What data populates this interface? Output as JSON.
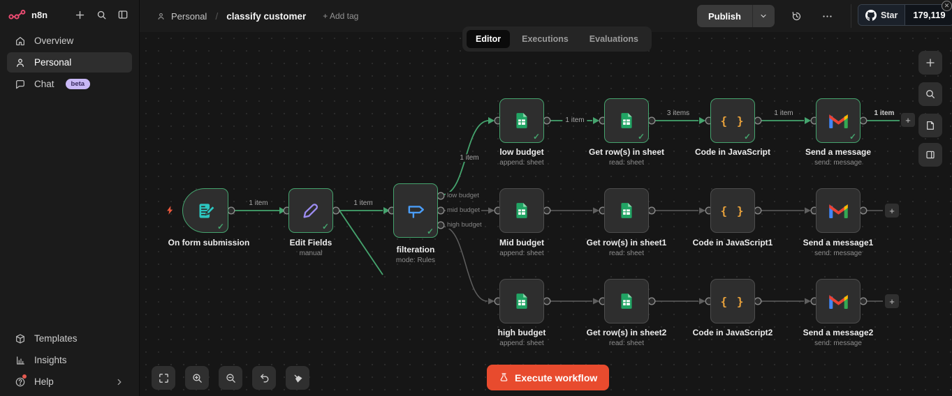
{
  "brand": {
    "name": "n8n"
  },
  "sidebar": {
    "items": [
      {
        "label": "Overview"
      },
      {
        "label": "Personal"
      },
      {
        "label": "Chat",
        "badge": "beta"
      }
    ],
    "footer": [
      {
        "label": "Templates"
      },
      {
        "label": "Insights"
      },
      {
        "label": "Help"
      }
    ]
  },
  "header": {
    "breadcrumb": {
      "project": "Personal",
      "separator": "/",
      "title": "classify customer"
    },
    "add_tag": "+ Add tag",
    "publish": "Publish",
    "github": {
      "star": "Star",
      "count": "179,119"
    }
  },
  "tabs": [
    {
      "label": "Editor"
    },
    {
      "label": "Executions"
    },
    {
      "label": "Evaluations"
    }
  ],
  "canvas": {
    "nodes": [
      {
        "name": "On form submission",
        "subtitle": ""
      },
      {
        "name": "Edit Fields",
        "subtitle": "manual"
      },
      {
        "name": "filteration",
        "subtitle": "mode: Rules"
      },
      {
        "name": "low budget",
        "subtitle": "append: sheet"
      },
      {
        "name": "Get row(s) in sheet",
        "subtitle": "read: sheet"
      },
      {
        "name": "Code in JavaScript",
        "subtitle": ""
      },
      {
        "name": "Send a message",
        "subtitle": "send: message"
      },
      {
        "name": "Mid budget",
        "subtitle": "append: sheet"
      },
      {
        "name": "Get row(s) in sheet1",
        "subtitle": "read: sheet"
      },
      {
        "name": "Code in JavaScript1",
        "subtitle": ""
      },
      {
        "name": "Send a message1",
        "subtitle": "send: message"
      },
      {
        "name": "high budget",
        "subtitle": "append: sheet"
      },
      {
        "name": "Get row(s) in sheet2",
        "subtitle": "read: sheet"
      },
      {
        "name": "Code in JavaScript2",
        "subtitle": ""
      },
      {
        "name": "Send a message2",
        "subtitle": "send: message"
      }
    ],
    "edge_labels": {
      "form_edit": "1 item",
      "edit_filter": "1 item",
      "filter_low": "1 item",
      "low_get": "1 item",
      "get_code": "3 items",
      "code_send": "1 item",
      "send_end": "1 item"
    },
    "output_labels": {
      "low": "low budget",
      "mid": "mid budget",
      "high": "high budget"
    },
    "execute": "Execute workflow"
  },
  "glyphs": {
    "check": "✓",
    "code": "{ }",
    "plus": "+"
  },
  "colors": {
    "accent_green": "#45a46e",
    "execute_red": "#e84b2e",
    "brand_pink": "#ea4b71",
    "canvas_bg": "#161616",
    "node_bg": "#2e2e2e"
  }
}
